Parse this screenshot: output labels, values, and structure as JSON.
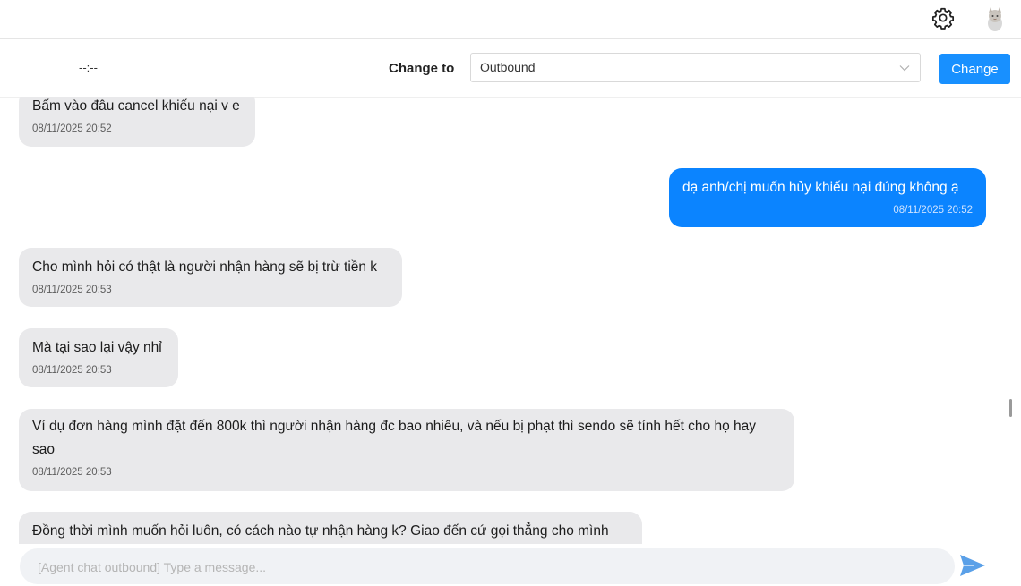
{
  "header": {
    "settings_icon": "gear-icon",
    "avatar_icon": "avatar"
  },
  "controls": {
    "timer": "--:--",
    "change_to_label": "Change to",
    "select_value": "Outbound",
    "change_button": "Change"
  },
  "messages": [
    {
      "direction": "in",
      "text": "Bấm vào đâu cancel khiếu nại v e",
      "time": "08/11/2025 20:52"
    },
    {
      "direction": "out",
      "text": "dạ anh/chị muốn hủy khiếu nại đúng không ạ",
      "time": "08/11/2025 20:52"
    },
    {
      "direction": "in",
      "text": "Cho mình hỏi có thật là người nhận hàng sẽ bị trừ tiền k",
      "time": "08/11/2025 20:53"
    },
    {
      "direction": "in",
      "text": "Mà tại sao lại vậy nhỉ",
      "time": "08/11/2025 20:53"
    },
    {
      "direction": "in",
      "text": "Ví dụ đơn hàng mình đặt đến 800k thì người nhận hàng đc bao nhiêu, và nếu bị phạt thì sendo sẽ tính hết cho họ hay sao",
      "time": "08/11/2025 20:53"
    },
    {
      "direction": "in",
      "text": "Đồng thời mình muốn hỏi luôn, có cách nào tự nhận hàng k? Giao đến cứ gọi thẳng cho mình",
      "time": ""
    }
  ],
  "composer": {
    "placeholder": "[Agent chat outbound] Type a message...",
    "value": "",
    "send_icon": "send-icon"
  },
  "colors": {
    "outgoing_bubble": "#0b84ff",
    "incoming_bubble": "#e9e9eb",
    "primary_button": "#1890ff"
  }
}
